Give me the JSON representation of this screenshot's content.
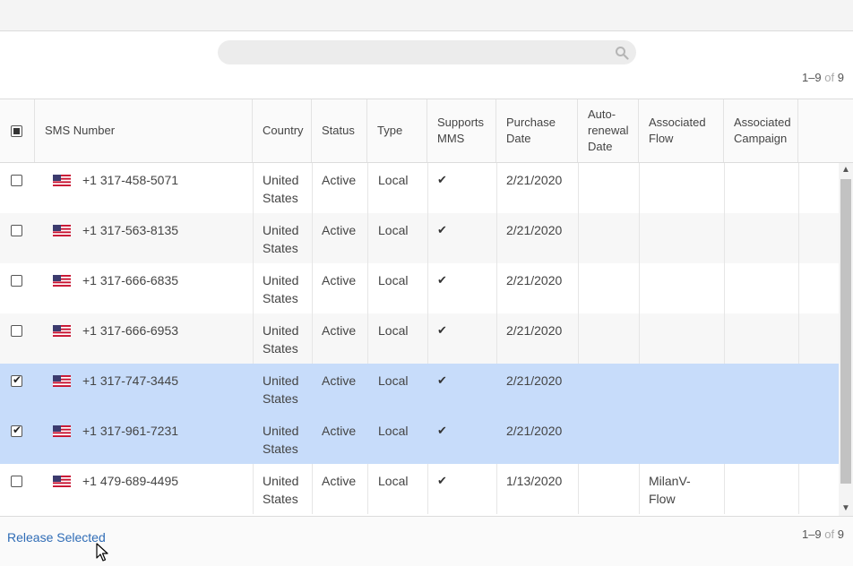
{
  "search": {
    "placeholder": ""
  },
  "pagination": {
    "range": "1–9",
    "of_label": "of",
    "total": "9"
  },
  "columns": {
    "sms_number": "SMS Number",
    "country": "Country",
    "status": "Status",
    "type": "Type",
    "supports_mms": [
      "Supports",
      "MMS"
    ],
    "purchase_date": [
      "Purchase",
      "Date"
    ],
    "auto_renewal": [
      "Auto-",
      "renewal",
      "Date"
    ],
    "associated_flow": [
      "Associated",
      "Flow"
    ],
    "associated_campaign": [
      "Associated",
      "Campaign"
    ]
  },
  "rows": [
    {
      "selected": false,
      "number": "+1 317-458-5071",
      "country": [
        "United",
        "States"
      ],
      "status": "Active",
      "type": "Local",
      "mms": "✔",
      "purchase": "2/21/2020",
      "renewal": "",
      "flow": [
        "",
        ""
      ],
      "campaign": ""
    },
    {
      "selected": false,
      "number": "+1 317-563-8135",
      "country": [
        "United",
        "States"
      ],
      "status": "Active",
      "type": "Local",
      "mms": "✔",
      "purchase": "2/21/2020",
      "renewal": "",
      "flow": [
        "",
        ""
      ],
      "campaign": ""
    },
    {
      "selected": false,
      "number": "+1 317-666-6835",
      "country": [
        "United",
        "States"
      ],
      "status": "Active",
      "type": "Local",
      "mms": "✔",
      "purchase": "2/21/2020",
      "renewal": "",
      "flow": [
        "",
        ""
      ],
      "campaign": ""
    },
    {
      "selected": false,
      "number": "+1 317-666-6953",
      "country": [
        "United",
        "States"
      ],
      "status": "Active",
      "type": "Local",
      "mms": "✔",
      "purchase": "2/21/2020",
      "renewal": "",
      "flow": [
        "",
        ""
      ],
      "campaign": ""
    },
    {
      "selected": true,
      "number": "+1 317-747-3445",
      "country": [
        "United",
        "States"
      ],
      "status": "Active",
      "type": "Local",
      "mms": "✔",
      "purchase": "2/21/2020",
      "renewal": "",
      "flow": [
        "",
        ""
      ],
      "campaign": ""
    },
    {
      "selected": true,
      "number": "+1 317-961-7231",
      "country": [
        "United",
        "States"
      ],
      "status": "Active",
      "type": "Local",
      "mms": "✔",
      "purchase": "2/21/2020",
      "renewal": "",
      "flow": [
        "",
        ""
      ],
      "campaign": ""
    },
    {
      "selected": false,
      "number": "+1 479-689-4495",
      "country": [
        "United",
        "States"
      ],
      "status": "Active",
      "type": "Local",
      "mms": "✔",
      "purchase": "1/13/2020",
      "renewal": "",
      "flow": [
        "MilanV-",
        "Flow"
      ],
      "campaign": ""
    }
  ],
  "footer": {
    "release_label": "Release Selected"
  },
  "colors": {
    "selected_row": "#c7dcfa",
    "link": "#2f6cb6",
    "alt_row": "#f7f7f7"
  },
  "icons": {
    "search": "search-icon",
    "flag": "us-flag-icon",
    "mms": "checkmark-icon",
    "cursor": "mouse-pointer-icon"
  }
}
